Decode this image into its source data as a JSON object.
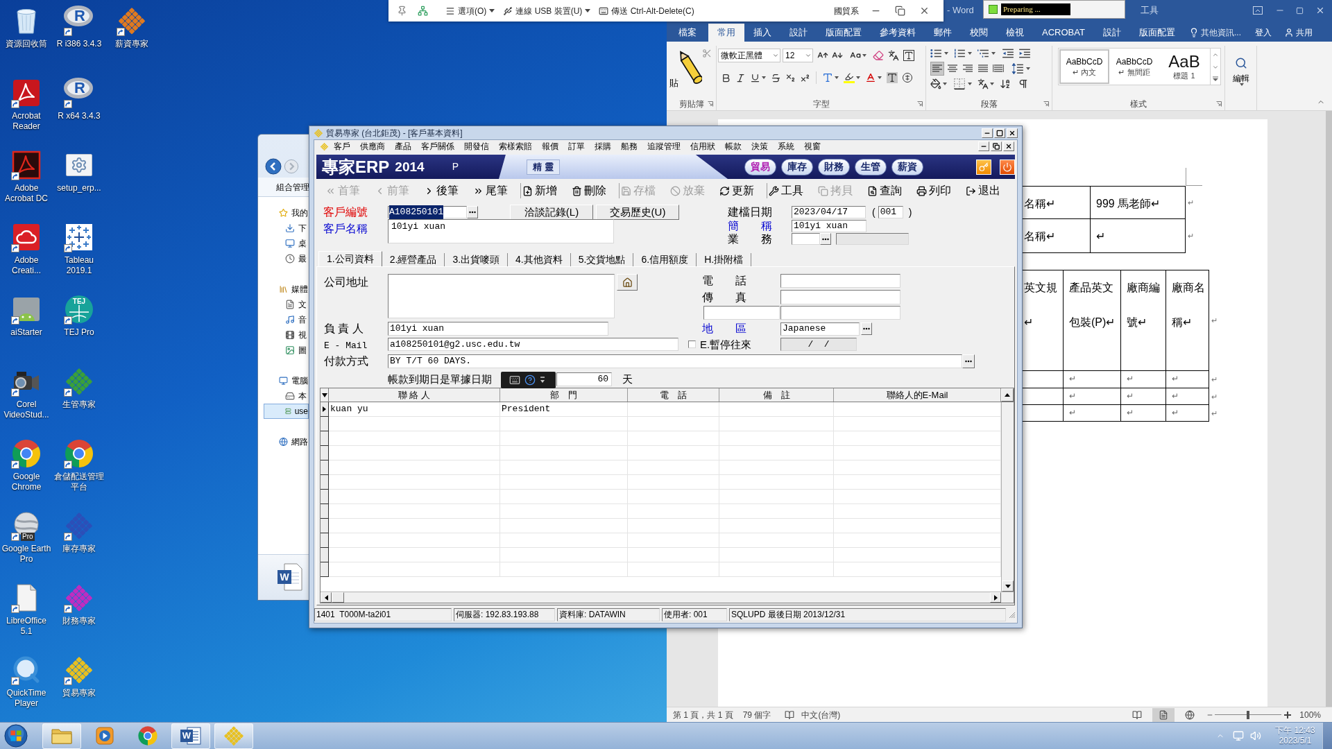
{
  "desktop": {
    "icons": [
      {
        "label": "資源回收筒",
        "kind": "recycle",
        "shortcut": false
      },
      {
        "label": "Acrobat Reader",
        "kind": "acrobat",
        "shortcut": true
      },
      {
        "label": "Adobe Acrobat DC",
        "kind": "acrobat-dc",
        "shortcut": true
      },
      {
        "label": "Adobe Creati...",
        "kind": "creative-cloud",
        "shortcut": true
      },
      {
        "label": "aiStarter",
        "kind": "android",
        "shortcut": true
      },
      {
        "label": "Corel VideoStud...",
        "kind": "camera",
        "shortcut": true
      },
      {
        "label": "Google Chrome",
        "kind": "chrome",
        "shortcut": true
      },
      {
        "label": "Google Earth Pro",
        "kind": "earth",
        "shortcut": true,
        "logo_text": "Pro"
      },
      {
        "label": "LibreOffice 5.1",
        "kind": "document",
        "shortcut": true
      },
      {
        "label": "QuickTime Player",
        "kind": "quicktime",
        "shortcut": true
      },
      {
        "label": "R i386 3.4.3",
        "kind": "r",
        "shortcut": true,
        "logo_text": "R"
      },
      {
        "label": "R x64 3.4.3",
        "kind": "r",
        "shortcut": true,
        "logo_text": "R"
      },
      {
        "label": "setup_erp...",
        "kind": "setup",
        "shortcut": false
      },
      {
        "label": "Tableau 2019.1",
        "kind": "tableau",
        "shortcut": true
      },
      {
        "label": "TEJ Pro",
        "kind": "tej",
        "shortcut": true,
        "logo_text": "TEJ"
      },
      {
        "label": "生管專家",
        "kind": "diamond",
        "color": "#3aa03a",
        "shortcut": true
      },
      {
        "label": "倉儲配送管理平台",
        "kind": "chrome",
        "shortcut": true
      },
      {
        "label": "庫存專家",
        "kind": "diamond",
        "color": "#2c4fb8",
        "shortcut": true
      },
      {
        "label": "財務專家",
        "kind": "diamond",
        "color": "#c02cc0",
        "shortcut": true
      },
      {
        "label": "貿易專家",
        "kind": "diamond",
        "color": "#e8c020",
        "shortcut": true
      },
      {
        "label": "薪資專家",
        "kind": "diamond",
        "color": "#e07a20",
        "shortcut": true
      }
    ]
  },
  "explorer": {
    "toolbar_label": "組合管理",
    "nav": [
      {
        "label": "我的",
        "kind": "star",
        "selected": false,
        "children": [
          {
            "label": "下",
            "kind": "download",
            "selected": false
          },
          {
            "label": "桌",
            "kind": "desktop",
            "selected": false
          },
          {
            "label": "最",
            "kind": "recent",
            "selected": false
          }
        ]
      },
      {
        "label": "媒體",
        "kind": "library",
        "selected": false,
        "children": [
          {
            "label": "文",
            "kind": "doc",
            "selected": false
          },
          {
            "label": "音",
            "kind": "music",
            "selected": false
          },
          {
            "label": "視",
            "kind": "video",
            "selected": false
          },
          {
            "label": "圖",
            "kind": "picture",
            "selected": false
          }
        ]
      },
      {
        "label": "電腦",
        "kind": "computer",
        "selected": false,
        "children": [
          {
            "label": "本",
            "kind": "drive",
            "selected": false
          },
          {
            "label": "use",
            "kind": "network-drive",
            "selected": true
          }
        ]
      },
      {
        "label": "網路",
        "kind": "network",
        "selected": false
      }
    ],
    "preview": {
      "logo_text": "W"
    }
  },
  "word": {
    "title": "- Word",
    "context_label": "工具",
    "tabs": [
      {
        "label": "檔案",
        "selected": false
      },
      {
        "label": "常用",
        "selected": true
      },
      {
        "label": "插入",
        "selected": false
      },
      {
        "label": "設計",
        "selected": false
      },
      {
        "label": "版面配置",
        "selected": false
      },
      {
        "label": "參考資料",
        "selected": false
      },
      {
        "label": "郵件",
        "selected": false
      },
      {
        "label": "校閱",
        "selected": false
      },
      {
        "label": "檢視",
        "selected": false
      },
      {
        "label": "ACROBAT",
        "selected": false
      },
      {
        "label": "設計",
        "selected": false
      },
      {
        "label": "版面配置",
        "selected": false
      }
    ],
    "tell_me": "其他資訊...",
    "sign_in": "登入",
    "share": "共用",
    "ribbon": {
      "clipboard": {
        "label": "剪貼簿",
        "paste": "貼"
      },
      "font": {
        "label": "字型",
        "name": "微軟正黑體",
        "size": "12"
      },
      "paragraph": {
        "label": "段落",
        "align": [
          {
            "kind": "left",
            "selected": true
          },
          {
            "kind": "center",
            "selected": false
          },
          {
            "kind": "right",
            "selected": false
          },
          {
            "kind": "justify",
            "selected": false
          },
          {
            "kind": "distributed",
            "selected": false
          }
        ]
      },
      "styles": {
        "label": "樣式",
        "items": [
          {
            "sample": "AaBbCcD",
            "name": "↵ 內文",
            "selected": true,
            "kind": "normal"
          },
          {
            "sample": "AaBbCcD",
            "name": "↵ 無間距",
            "selected": false,
            "kind": "normal"
          },
          {
            "sample": "AaB",
            "name": "標題 1",
            "selected": false,
            "kind": "heading"
          }
        ]
      },
      "editing": {
        "label": "編輯"
      }
    },
    "document": {
      "tables": [
        {
          "rows": [
            {
              "cells": [
                {
                  "lines": [
                    "名稱↵"
                  ]
                },
                {
                  "lines": [
                    "999 馬老師↵"
                  ]
                }
              ],
              "end_mark": "↵"
            },
            {
              "cells": [
                {
                  "lines": [
                    "名稱↵"
                  ]
                },
                {
                  "lines": [
                    "↵"
                  ]
                }
              ],
              "end_mark": "↵"
            }
          ]
        },
        {
          "rows": [
            {
              "cells": [
                {
                  "lines": [
                    "英文規",
                    "↵"
                  ]
                },
                {
                  "lines": [
                    "產品英文",
                    "包裝(P)↵"
                  ]
                },
                {
                  "lines": [
                    "廠商編",
                    "號↵"
                  ]
                },
                {
                  "lines": [
                    "廠商名",
                    "稱↵"
                  ]
                }
              ],
              "end_mark": "↵"
            },
            {
              "cells": [
                {},
                {
                  "lines": [
                    "↵"
                  ]
                },
                {
                  "lines": [
                    "↵"
                  ]
                },
                {
                  "lines": [
                    "↵"
                  ]
                }
              ],
              "end_mark": "↵"
            },
            {
              "cells": [
                {},
                {
                  "lines": [
                    "↵"
                  ]
                },
                {
                  "lines": [
                    "↵"
                  ]
                },
                {
                  "lines": [
                    "↵"
                  ]
                }
              ],
              "end_mark": "↵"
            },
            {
              "cells": [
                {},
                {
                  "lines": [
                    "↵"
                  ]
                },
                {
                  "lines": [
                    "↵"
                  ]
                },
                {
                  "lines": [
                    "↵"
                  ]
                }
              ],
              "end_mark": "↵"
            }
          ]
        }
      ]
    },
    "status": {
      "page": "第 1 頁，共 1 頁",
      "words": "79 個字",
      "language": "中文(台灣)",
      "views": [
        {
          "kind": "read",
          "selected": false
        },
        {
          "kind": "print",
          "selected": true
        },
        {
          "kind": "web",
          "selected": false
        }
      ],
      "zoom": {
        "label": "100%",
        "level": 0.5
      }
    }
  },
  "progress": {
    "text": "Preparing ..."
  },
  "vm_toolbar": {
    "menus": [
      {
        "label": "選項(O)",
        "kind": "options",
        "dropdown": true
      },
      {
        "label": "連線 USB 裝置(U)",
        "kind": "usb",
        "dropdown": true
      },
      {
        "label": "傳送 Ctrl-Alt-Delete(C)",
        "kind": "keyboard",
        "dropdown": false
      }
    ],
    "title": "國貿系"
  },
  "erp": {
    "title": "貿易專家 (台北鉅茂) - [客戶基本資料]",
    "menu": [
      "客戶",
      "供應商",
      "產品",
      "客戶關係",
      "開發信",
      "索樣索賠",
      "報價",
      "訂單",
      "採購",
      "船務",
      "追蹤管理",
      "信用狀",
      "帳款",
      "決策",
      "系統",
      "視窗"
    ],
    "banner": {
      "brand": "專家ERP",
      "year": "2014",
      "edition": "P",
      "wizard": "精 靈",
      "modules": [
        {
          "label": "貿易",
          "selected": true
        },
        {
          "label": "庫存",
          "selected": false
        },
        {
          "label": "財務",
          "selected": false
        },
        {
          "label": "生管",
          "selected": false
        },
        {
          "label": "薪資",
          "selected": false
        }
      ]
    },
    "toolbar": [
      {
        "label": "首筆",
        "kind": "first",
        "disabled": true,
        "group_start": false
      },
      {
        "label": "前筆",
        "kind": "prev",
        "disabled": true,
        "group_start": false
      },
      {
        "label": "後筆",
        "kind": "next",
        "disabled": false,
        "group_start": false
      },
      {
        "label": "尾筆",
        "kind": "last",
        "disabled": false,
        "group_start": false
      },
      {
        "label": "新增",
        "kind": "add",
        "disabled": false,
        "group_start": true
      },
      {
        "label": "刪除",
        "kind": "delete",
        "disabled": false,
        "group_start": false
      },
      {
        "label": "存檔",
        "kind": "save",
        "disabled": true,
        "group_start": true
      },
      {
        "label": "放棄",
        "kind": "cancel",
        "disabled": true,
        "group_start": false
      },
      {
        "label": "更新",
        "kind": "update",
        "disabled": false,
        "group_start": false
      },
      {
        "label": "工具",
        "kind": "tools",
        "disabled": false,
        "group_start": true
      },
      {
        "label": "拷貝",
        "kind": "copy",
        "disabled": true,
        "group_start": false
      },
      {
        "label": "查詢",
        "kind": "query",
        "disabled": false,
        "group_start": false
      },
      {
        "label": "列印",
        "kind": "print",
        "disabled": false,
        "group_start": false
      },
      {
        "label": "退出",
        "kind": "exit",
        "disabled": false,
        "group_start": false
      }
    ],
    "header": {
      "customer_no": {
        "label": "客戶編號",
        "color": "#e00000",
        "value": "A108250101",
        "highlighted": true
      },
      "customer_name": {
        "label": "客戶名稱",
        "color": "#0000d0",
        "value": "101yi xuan"
      },
      "buttons": [
        "洽談記錄(L)",
        "交易歷史(U)"
      ],
      "created": {
        "label": "建檔日期",
        "value": "2023/04/17",
        "open": "(",
        "code": "001",
        "close": ")"
      },
      "short_name": {
        "label": "簡　　稱",
        "color": "#0000d0",
        "value": "101yi xuan"
      },
      "sales": {
        "label": "業　　務"
      }
    },
    "tabs": [
      {
        "label": "1.公司資料",
        "selected": true
      },
      {
        "label": "2.經營產品",
        "selected": false
      },
      {
        "label": "3.出貨嘜頭",
        "selected": false
      },
      {
        "label": "4.其他資料",
        "selected": false
      },
      {
        "label": "5.交貨地點",
        "selected": false
      },
      {
        "label": "6.信用額度",
        "selected": false
      },
      {
        "label": "H.掛附檔",
        "selected": false
      }
    ],
    "company": {
      "address": {
        "label": "公司地址"
      },
      "phone": {
        "label": "電　　話"
      },
      "fax": {
        "label": "傳　　真"
      },
      "owner": {
        "label": "負 責 人",
        "value": "101yi xuan"
      },
      "region": {
        "label": "地　　區",
        "color": "#0000d0",
        "value": "Japanese"
      },
      "email": {
        "label": "E - Mail",
        "value": "a108250101@g2.usc.edu.tw"
      },
      "suspend": {
        "label": "E.暫停往來",
        "checked": false
      },
      "suspend_date": "/  /",
      "payment": {
        "label": "付款方式",
        "value": "BY T/T 60 DAYS."
      },
      "due": {
        "text": "帳款到期日是單據日期",
        "days": "60",
        "unit": "天"
      }
    },
    "grid": {
      "columns": [
        "聯 絡 人",
        "部　門",
        "電　話",
        "備　註",
        "聯絡人的E-Mail"
      ],
      "rows": [
        {
          "cells": [
            "kuan yu",
            "President"
          ],
          "selected": true
        }
      ]
    },
    "status_bar": [
      "1401  T000M-ta2i01",
      "伺服器: 192.83.193.88",
      "資料庫: DATAWIN",
      "使用者: 001",
      "SQLUPD 最後日期 2013/12/31"
    ]
  },
  "taskbar": {
    "apps": [
      {
        "kind": "explorer",
        "open": true
      },
      {
        "kind": "media",
        "open": false
      },
      {
        "kind": "chrome",
        "open": false
      },
      {
        "kind": "word",
        "open": true,
        "logo_text": "W"
      },
      {
        "kind": "erp",
        "open": true,
        "color": "#e8c020"
      }
    ],
    "clock": {
      "time": "下午 12:43",
      "date": "2023/5/1"
    }
  }
}
